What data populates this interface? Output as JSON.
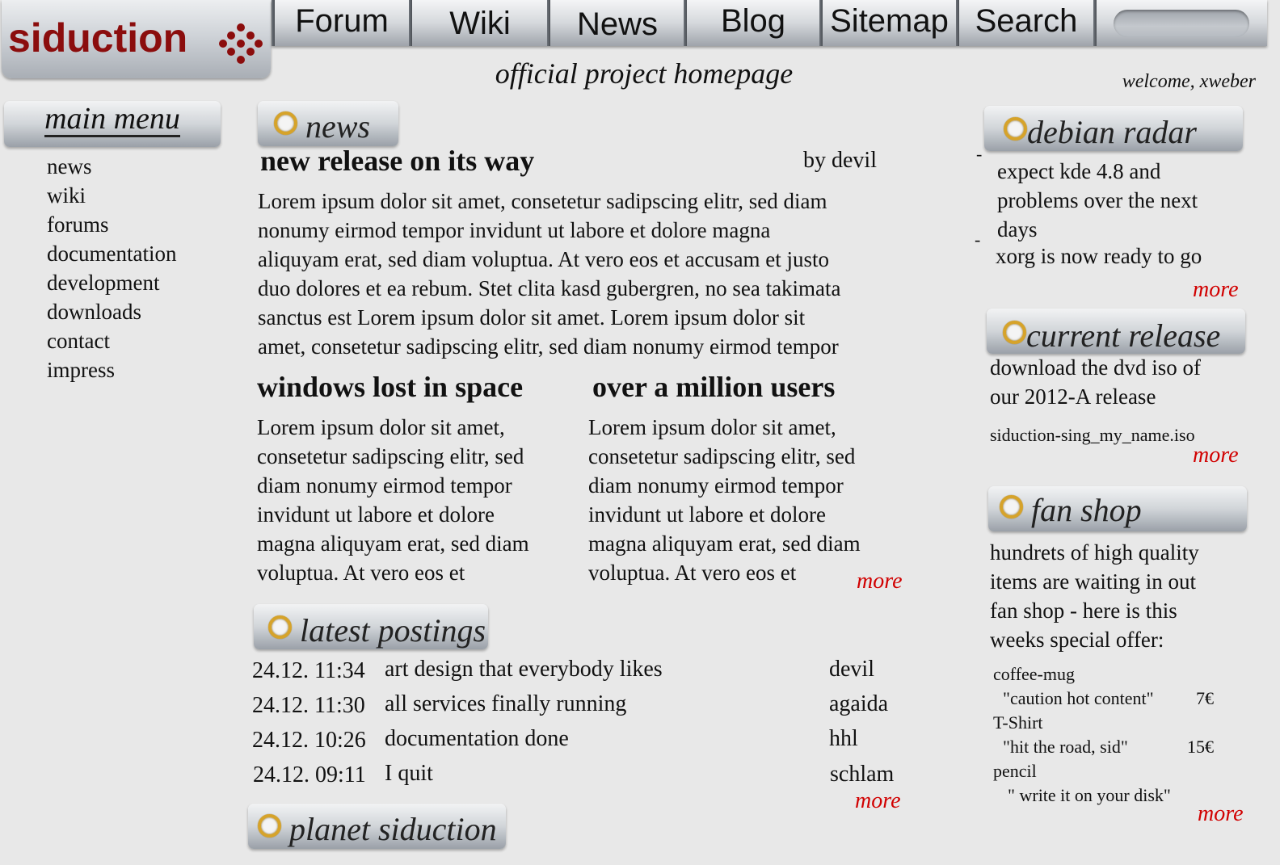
{
  "logo": {
    "text": "siduction"
  },
  "nav": {
    "items": [
      "Forum",
      "Wiki",
      "News",
      "Blog",
      "Sitemap",
      "Search"
    ],
    "search_value": ""
  },
  "header": {
    "tagline": "official project homepage",
    "welcome": "welcome, xweber"
  },
  "main_menu": {
    "title": "main menu",
    "items": [
      "news",
      "wiki",
      "forums",
      "documentation",
      "development",
      "downloads",
      "contact",
      "impress"
    ]
  },
  "news": {
    "title": "news",
    "lead": {
      "headline": "new release on its way",
      "author": "by devil",
      "lines": [
        "Lorem ipsum dolor sit amet, consetetur sadipscing elitr, sed diam",
        "nonumy eirmod tempor invidunt ut labore et dolore magna",
        "aliquyam erat, sed diam voluptua. At vero eos et accusam et justo",
        "duo dolores et ea rebum. Stet clita kasd gubergren, no sea takimata",
        "sanctus est Lorem ipsum dolor sit amet. Lorem ipsum dolor sit",
        "amet, consetetur sadipscing elitr, sed diam nonumy eirmod tempor"
      ]
    },
    "articles": [
      {
        "headline": "windows lost in space",
        "lines": [
          "Lorem ipsum dolor sit amet,",
          "consetetur sadipscing elitr, sed",
          "diam nonumy eirmod tempor",
          "invidunt ut labore et dolore",
          "magna aliquyam erat, sed diam",
          "voluptua. At vero eos et"
        ]
      },
      {
        "headline": "over a million users",
        "lines": [
          "Lorem ipsum dolor sit amet,",
          "consetetur sadipscing elitr, sed",
          "diam nonumy eirmod tempor",
          "invidunt ut labore et dolore",
          "magna aliquyam erat, sed diam",
          "voluptua. At vero eos et"
        ]
      }
    ],
    "more": "more"
  },
  "latest_postings": {
    "title": "latest postings",
    "rows": [
      {
        "time": "24.12. 11:34",
        "subject": "art design that everybody likes",
        "user": "devil"
      },
      {
        "time": "24.12. 11:30",
        "subject": "all services finally running",
        "user": "agaida"
      },
      {
        "time": "24.12. 10:26",
        "subject": "documentation done",
        "user": "hhl"
      },
      {
        "time": "24.12. 09:11",
        "subject": "I quit",
        "user": "schlam"
      }
    ],
    "more": "more"
  },
  "planet": {
    "title": "planet siduction"
  },
  "debian_radar": {
    "title": "debian radar",
    "items": [
      {
        "bullet": "-",
        "lines": [
          "expect kde 4.8 and",
          "problems over the next",
          "days"
        ]
      },
      {
        "bullet": "-",
        "lines": [
          "xorg is now ready to go"
        ]
      }
    ],
    "more": "more"
  },
  "current_release": {
    "title": "current release",
    "lines": [
      "download the dvd iso of",
      "our 2012-A release"
    ],
    "file": "siduction-sing_my_name.iso",
    "more": "more"
  },
  "fan_shop": {
    "title": "fan shop",
    "lines": [
      "hundrets of high quality",
      "items are waiting in out",
      "fan shop - here is this",
      "weeks special offer:"
    ],
    "offers": [
      {
        "item": "coffee-mug",
        "desc": "\"caution hot content\"",
        "price": "7€"
      },
      {
        "item": "T-Shirt",
        "desc": "\"hit the road, sid\"",
        "price": "15€"
      },
      {
        "item": "pencil",
        "desc": "\" write it on your disk\"",
        "price": ""
      }
    ],
    "more": "more"
  },
  "colors": {
    "brand": "#8b0d0d",
    "more_link": "#d10000",
    "ring": "#d6a32a"
  }
}
